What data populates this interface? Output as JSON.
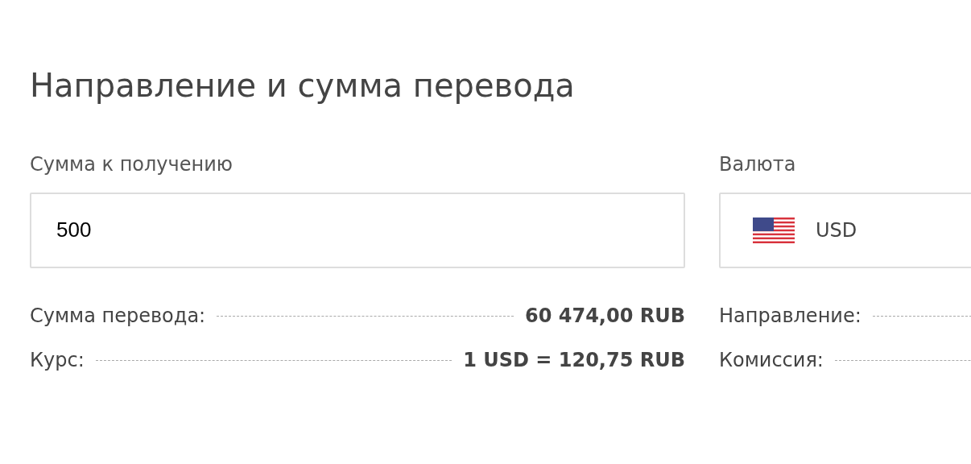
{
  "title": "Направление и сумма перевода",
  "columns": [
    {
      "label": "Сумма к получению",
      "field": {
        "kind": "input",
        "value": "500"
      },
      "rows": [
        {
          "label": "Сумма перевода:",
          "value": "60 474,00 RUB"
        },
        {
          "label": "Курс:",
          "value": "1 USD = 120,75 RUB"
        }
      ]
    },
    {
      "label": "Валюта",
      "field": {
        "kind": "currency",
        "value": "USD"
      },
      "rows": [
        {
          "label": "Направление:"
        },
        {
          "label": "Комиссия:"
        }
      ]
    }
  ]
}
